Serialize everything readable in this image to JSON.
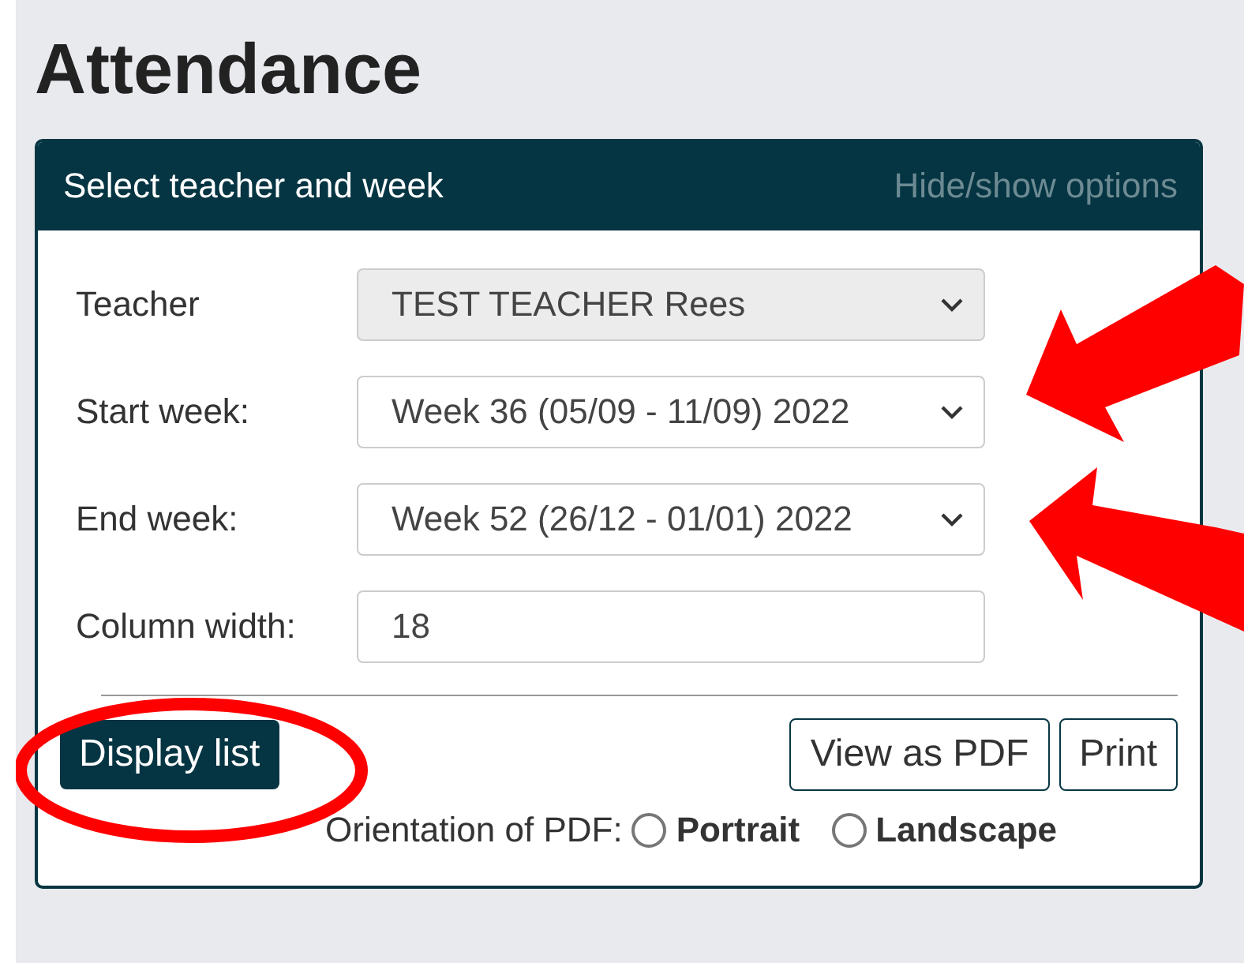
{
  "page_title": "Attendance",
  "panel": {
    "title": "Select teacher and week",
    "toggle": "Hide/show options"
  },
  "fields": [
    {
      "kind": "select",
      "label": "Teacher",
      "value": "TEST TEACHER Rees",
      "disabled": true
    },
    {
      "kind": "select",
      "label": "Start week:",
      "value": "Week 36 (05/09 - 11/09) 2022",
      "disabled": false
    },
    {
      "kind": "select",
      "label": "End week:",
      "value": "Week 52 (26/12 - 01/01) 2022",
      "disabled": false
    },
    {
      "kind": "input",
      "label": "Column width:",
      "value": "18",
      "disabled": false
    }
  ],
  "primary_button": "Display list",
  "secondary_buttons": [
    "View as PDF",
    "Print"
  ],
  "orientation": {
    "label": "Orientation of PDF:",
    "options": [
      {
        "label": "Portrait",
        "selected": false
      },
      {
        "label": "Landscape",
        "selected": false
      }
    ]
  }
}
